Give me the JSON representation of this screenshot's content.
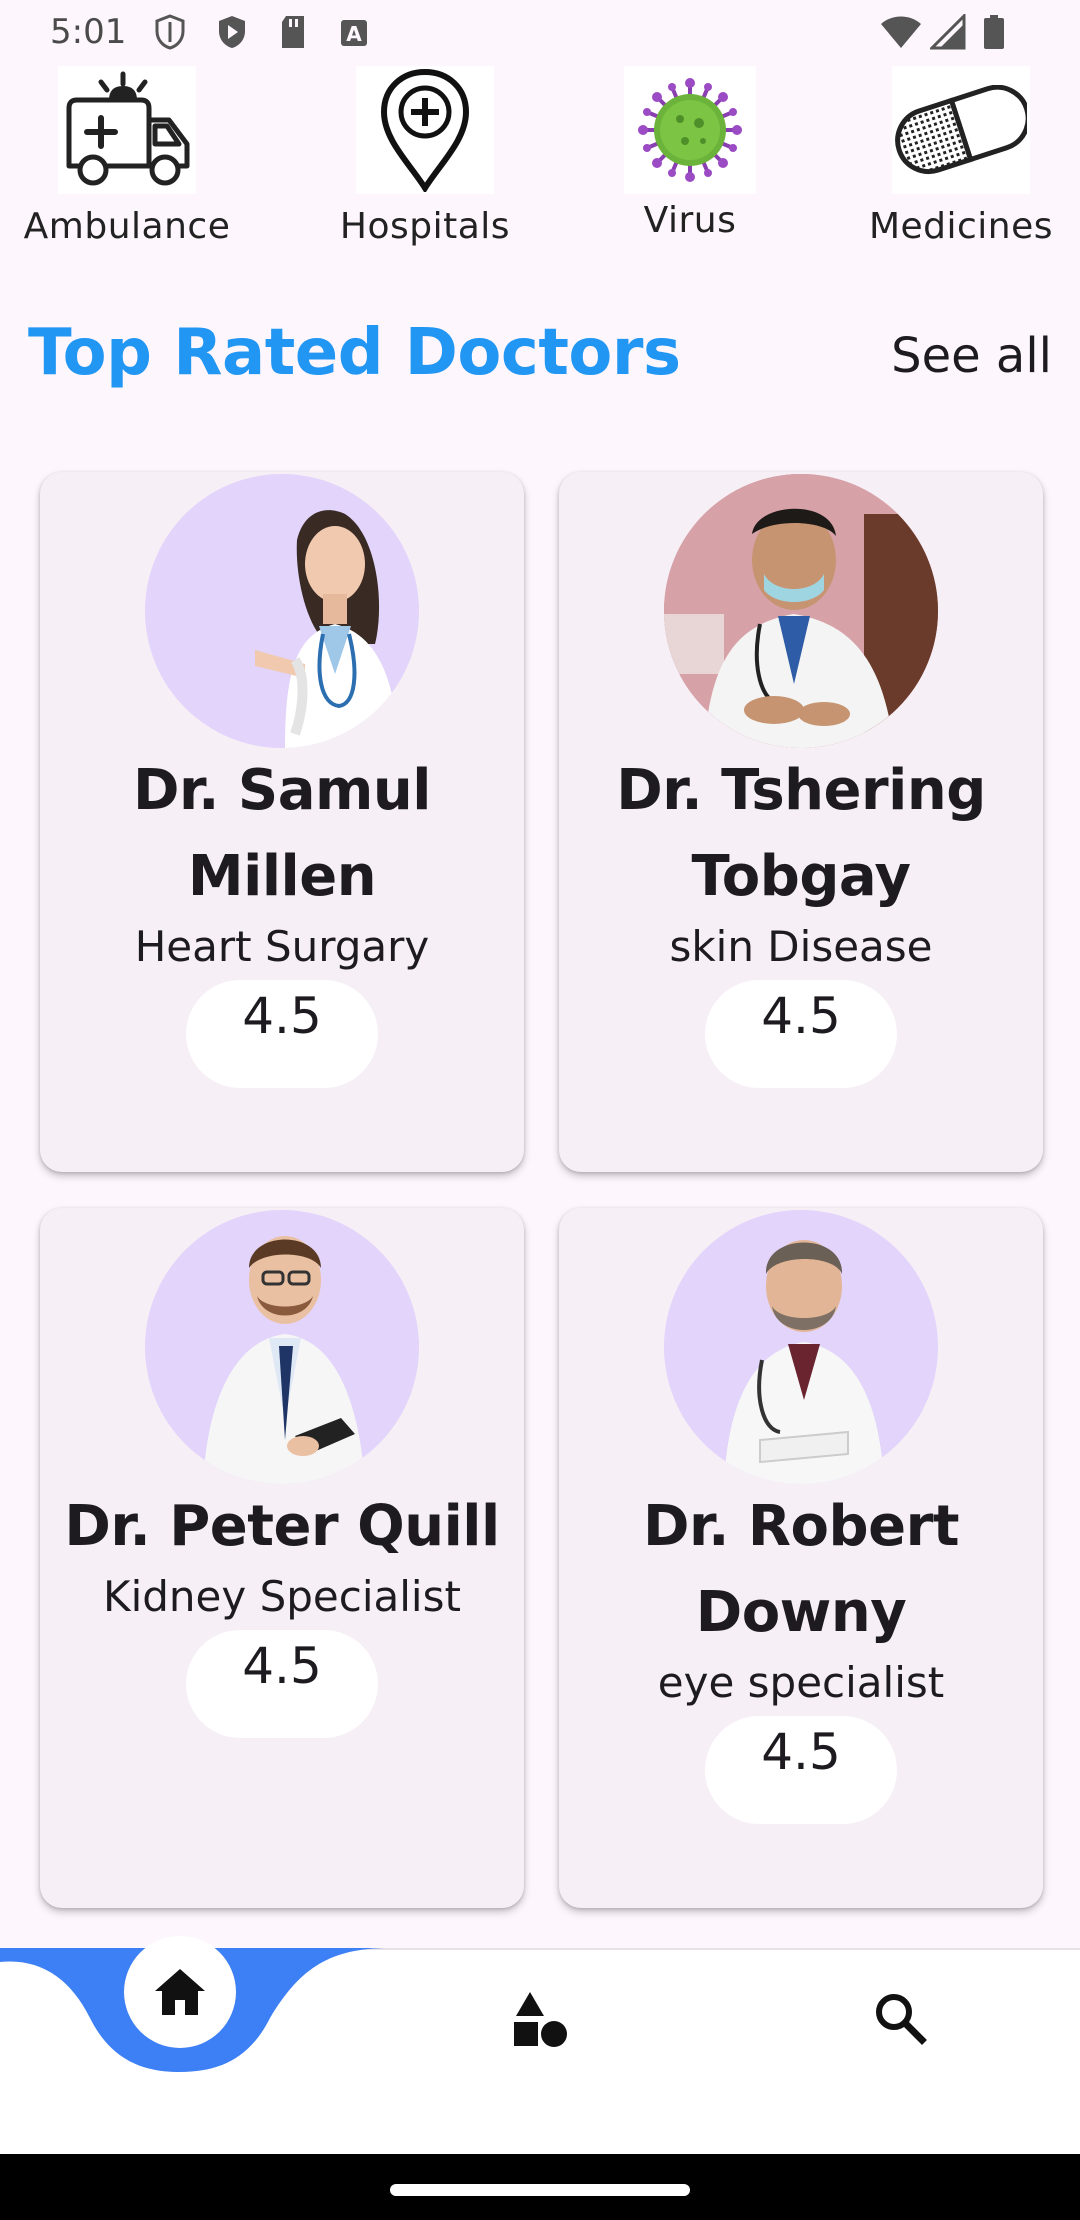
{
  "status_bar": {
    "time": "5:01"
  },
  "categories": [
    {
      "label": "Ambulance",
      "icon": "ambulance-icon"
    },
    {
      "label": "Hospitals",
      "icon": "hospital-pin-icon"
    },
    {
      "label": "Virus",
      "icon": "virus-icon"
    },
    {
      "label": "Medicines",
      "icon": "pill-icon"
    }
  ],
  "section": {
    "title": "Top Rated Doctors",
    "see_all": "See all",
    "title_color": "#2196f3"
  },
  "doctors": [
    {
      "name": "Dr. Samul  Millen",
      "specialty": "Heart Surgary",
      "rating": "4.5"
    },
    {
      "name": "Dr. Tshering Tobgay",
      "specialty": "skin Disease",
      "rating": "4.5"
    },
    {
      "name": "Dr. Peter Quill",
      "specialty": "Kidney Specialist",
      "rating": "4.5"
    },
    {
      "name": "Dr. Robert Downy",
      "specialty": "eye specialist",
      "rating": "4.5"
    }
  ],
  "bottom_nav": {
    "items": [
      {
        "icon": "home-icon",
        "active": true
      },
      {
        "icon": "category-shapes-icon",
        "active": false
      },
      {
        "icon": "search-icon",
        "active": false
      }
    ],
    "accent": "#3d7ff5"
  }
}
